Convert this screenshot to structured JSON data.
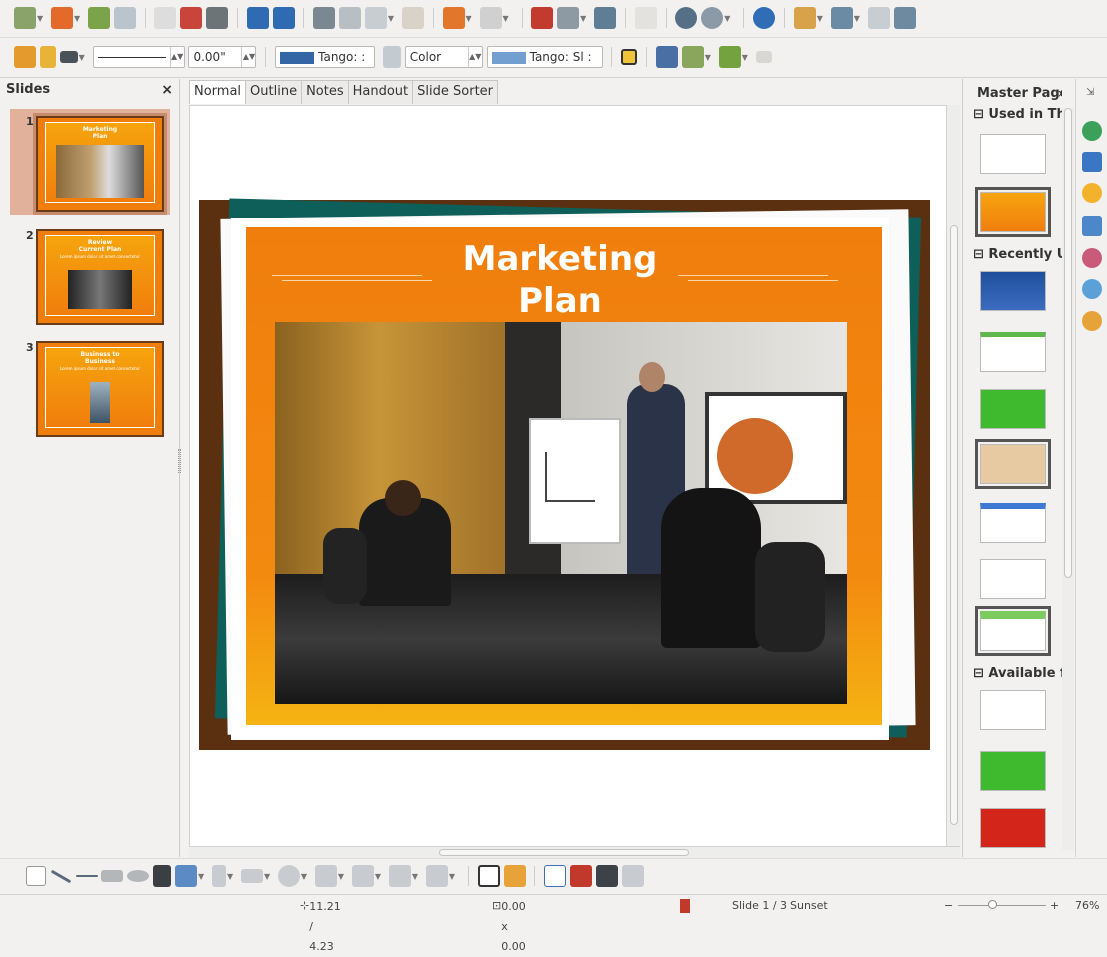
{
  "sidebar_panel": {
    "title": "Slides",
    "close": "×"
  },
  "slides": [
    {
      "number": "1",
      "title": "Marketing Plan"
    },
    {
      "number": "2",
      "title": "Review Current Plan",
      "subtitle": "Lorem ipsum dolor sit amet consectetur"
    },
    {
      "number": "3",
      "title": "Business to Business",
      "subtitle": "Lorem ipsum dolor sit amet consectetur"
    }
  ],
  "view_tabs": [
    "Normal",
    "Outline",
    "Notes",
    "Handout",
    "Slide Sorter"
  ],
  "slide": {
    "title_line1": "Marketing",
    "title_line2": "Plan"
  },
  "line_toolbar": {
    "line_width": "0.00\"",
    "line_color": "Tango: :",
    "area_style": "Color",
    "area_color": "Tango: Sl :"
  },
  "master_pages": {
    "title": "Master Pages",
    "section_used": "⊟ Used in This",
    "section_recent": "⊟ Recently Us",
    "section_available": "⊟ Available fo"
  },
  "status": {
    "position": "11.21 / 4.23",
    "size": "0.00 x 0.00",
    "slide_info": "Slide 1 / 3",
    "master": "Sunset",
    "zoom_minus": "−",
    "zoom_plus": "+",
    "zoom": "76%"
  },
  "colors": {
    "slide_orange": "#f07e0d",
    "slide_brown": "#5a3010",
    "slide_teal": "#0e5f5a",
    "tango_blue": "#3465a4"
  },
  "icons": [
    "new-icon",
    "open-icon",
    "save-icon",
    "export-icon",
    "pdf-icon",
    "print-icon",
    "spellcheck-icon",
    "autospell-icon",
    "cut-icon",
    "copy-icon",
    "paste-icon",
    "clone-icon",
    "undo-icon",
    "redo-icon",
    "chart-icon",
    "table-icon",
    "image-icon",
    "grid-icon",
    "navigator-icon",
    "zoom-icon",
    "help-icon",
    "presentation-icon",
    "display-icon",
    "slide-icon",
    "export-slide-icon"
  ]
}
